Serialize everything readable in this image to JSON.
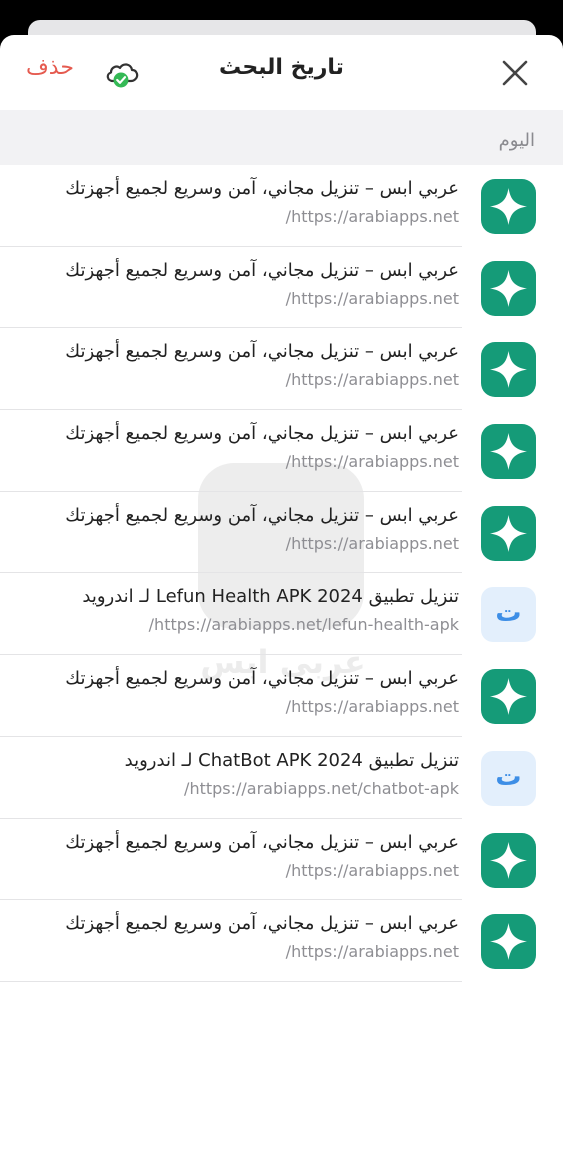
{
  "header": {
    "title": "تاريخ البحث",
    "delete_label": "حذف",
    "icons": {
      "close": "close-icon",
      "cloud_sync": "cloud-check-icon"
    }
  },
  "colors": {
    "delete_text": "#e55a4f",
    "site_icon_green": "#159b78",
    "letter_icon_bg": "#e3effc",
    "letter_icon_fg": "#3d8ee6"
  },
  "section": {
    "label": "اليوم"
  },
  "watermark": {
    "text": "عربي ابس"
  },
  "history": [
    {
      "title": "عربي ابس – تنزيل مجاني، آمن وسريع لجميع أجهزتك",
      "url": "https://arabiapps.net/",
      "icon": "sparkle-icon"
    },
    {
      "title": "عربي ابس – تنزيل مجاني، آمن وسريع لجميع أجهزتك",
      "url": "https://arabiapps.net/",
      "icon": "sparkle-icon"
    },
    {
      "title": "عربي ابس – تنزيل مجاني، آمن وسريع لجميع أجهزتك",
      "url": "https://arabiapps.net/",
      "icon": "sparkle-icon"
    },
    {
      "title": "عربي ابس – تنزيل مجاني، آمن وسريع لجميع أجهزتك",
      "url": "https://arabiapps.net/",
      "icon": "sparkle-icon"
    },
    {
      "title": "عربي ابس – تنزيل مجاني، آمن وسريع لجميع أجهزتك",
      "url": "https://arabiapps.net/",
      "icon": "sparkle-icon"
    },
    {
      "title": "تنزيل تطبيق Lefun Health APK 2024 لـ اندرويد",
      "url": "https://arabiapps.net/lefun-health-apk/",
      "icon": "letter-icon",
      "icon_letter": "ت"
    },
    {
      "title": "عربي ابس – تنزيل مجاني، آمن وسريع لجميع أجهزتك",
      "url": "https://arabiapps.net/",
      "icon": "sparkle-icon"
    },
    {
      "title": "تنزيل تطبيق ChatBot APK 2024 لـ اندرويد",
      "url": "https://arabiapps.net/chatbot-apk/",
      "icon": "letter-icon",
      "icon_letter": "ت"
    },
    {
      "title": "عربي ابس – تنزيل مجاني، آمن وسريع لجميع أجهزتك",
      "url": "https://arabiapps.net/",
      "icon": "sparkle-icon"
    },
    {
      "title": "عربي ابس – تنزيل مجاني، آمن وسريع لجميع أجهزتك",
      "url": "https://arabiapps.net/",
      "icon": "sparkle-icon"
    }
  ]
}
